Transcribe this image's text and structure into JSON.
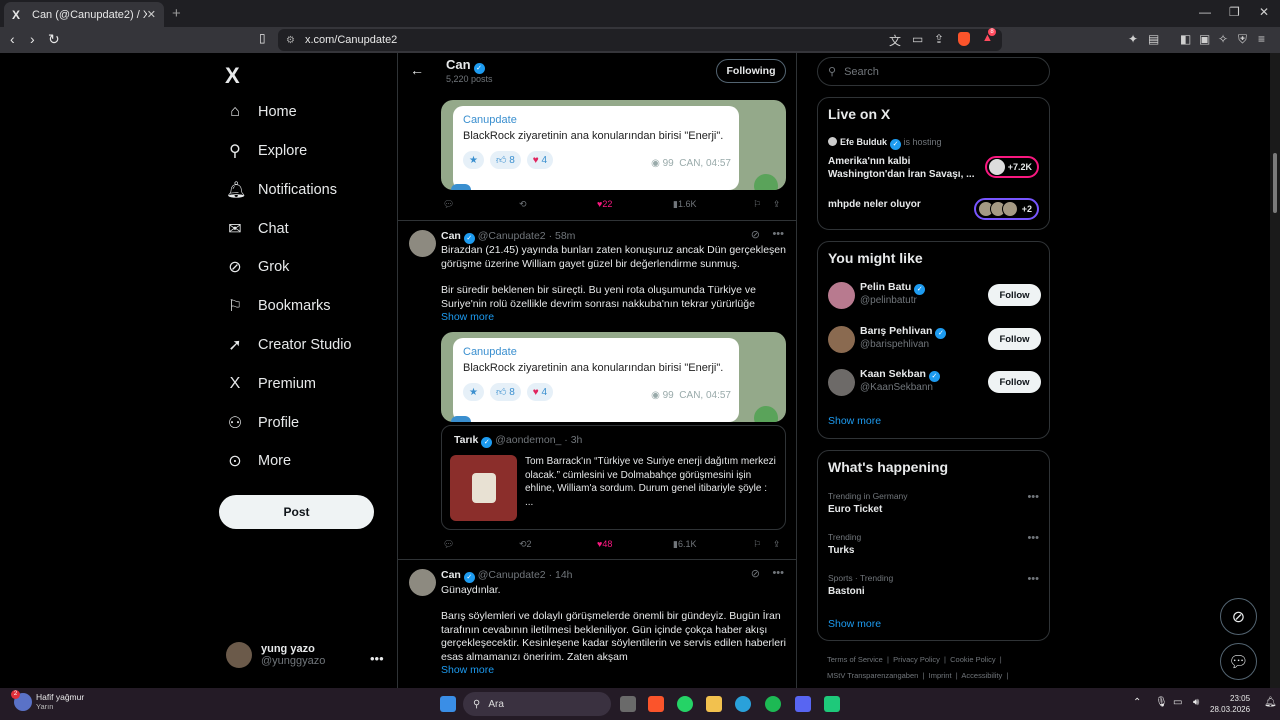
{
  "browser": {
    "tab_title": "Can (@Canupdate2) / X",
    "tab_favicon": "X",
    "url": "x.com/Canupdate2",
    "shield_badge": "8"
  },
  "sidebar": {
    "logo": "X",
    "items": [
      {
        "label": "Home",
        "icon": "home-icon"
      },
      {
        "label": "Explore",
        "icon": "search-icon"
      },
      {
        "label": "Notifications",
        "icon": "bell-icon"
      },
      {
        "label": "Chat",
        "icon": "mail-icon"
      },
      {
        "label": "Grok",
        "icon": "grok-icon"
      },
      {
        "label": "Bookmarks",
        "icon": "bookmark-icon"
      },
      {
        "label": "Creator Studio",
        "icon": "rocket-icon"
      },
      {
        "label": "Premium",
        "icon": "x-logo-icon"
      },
      {
        "label": "Profile",
        "icon": "person-icon"
      },
      {
        "label": "More",
        "icon": "more-circle-icon"
      }
    ],
    "post_label": "Post",
    "account": {
      "name": "yung yazo",
      "handle": "@yunggyazo"
    }
  },
  "profile": {
    "name": "Can",
    "posts": "5,220 posts",
    "following_label": "Following"
  },
  "embed": {
    "channel": "Canupdate",
    "message": "BlackRock ziyaretinin ana konularından birisi \"Enerji\".",
    "reaction_star": "★",
    "reaction_like": "8",
    "reaction_heart": "4",
    "views": "99",
    "meta": "CAN, 04:57"
  },
  "tweets": [
    {
      "actions": {
        "likes": "22",
        "views": "1.6K"
      }
    },
    {
      "name": "Can",
      "handle": "@Canupdate2",
      "time": "· 58m",
      "text1": "Birazdan (21.45) yayında bunları zaten konuşuruz ancak Dün gerçekleşen görüşme üzerine William gayet güzel bir değerlendirme sunmuş.",
      "text2": "Bir süredir beklenen bir süreçti. Bu yeni rota oluşumunda Türkiye ve Suriye'nin rolü özellikle devrim sonrası nakkuba'nın tekrar yürürlüğe",
      "show_more": "Show more",
      "quote": {
        "name": "Tarık",
        "handle": "@aondemon_",
        "time": "· 3h",
        "text": "Tom Barrack'ın “Türkiye ve Suriye enerji dağıtım merkezi olacak.” cümlesini ve Dolmabahçe görüşmesini işin ehline, William'a sordum. Durum genel itibariyle şöyle :",
        "ellipsis": "..."
      },
      "actions": {
        "reposts": "2",
        "likes": "48",
        "views": "6.1K"
      }
    },
    {
      "name": "Can",
      "handle": "@Canupdate2",
      "time": "· 14h",
      "text1": "Günaydınlar.",
      "text2": "Barış söylemleri ve dolaylı görüşmelerde önemli bir gündeyiz. Bugün İran tarafının cevabının iletilmesi bekleniliyor. Gün içinde çokça haber akışı gerçekleşecektir. Kesinleşene kadar söylentilerin ve servis edilen haberleri esas almamanızı öneririm. Zaten akşam",
      "show_more": "Show more"
    }
  ],
  "right": {
    "search_placeholder": "Search",
    "live": {
      "title": "Live on X",
      "host_name": "Efe Bulduk",
      "host_suffix": "is hosting",
      "item1": "Amerika'nın kalbi Washington'dan İran Savaşı, ...",
      "item1_count": "+7.2K",
      "item2": "mhpde neler oluyor",
      "item2_count": "+2"
    },
    "might_like": {
      "title": "You might like",
      "people": [
        {
          "name": "Pelin Batu",
          "handle": "@pelinbatutr",
          "button": "Follow"
        },
        {
          "name": "Barış Pehlivan",
          "handle": "@barispehlivan",
          "button": "Follow"
        },
        {
          "name": "Kaan Sekban",
          "handle": "@KaanSekbann",
          "button": "Follow"
        }
      ],
      "show_more": "Show more"
    },
    "happening": {
      "title": "What's happening",
      "trends": [
        {
          "context": "Trending in Germany",
          "name": "Euro Ticket"
        },
        {
          "context": "Trending",
          "name": "Turks"
        },
        {
          "context": "Sports · Trending",
          "name": "Bastoni"
        }
      ],
      "show_more": "Show more"
    },
    "footer": {
      "line1": [
        "Terms of Service",
        "Privacy Policy",
        "Cookie Policy"
      ],
      "line2": [
        "MStV Transparenzangaben",
        "Imprint",
        "Accessibility"
      ]
    }
  },
  "taskbar": {
    "weather_title": "Hafif yağmur",
    "weather_sub": "Yarın",
    "weather_badge": "2",
    "search_label": "Ara",
    "time": "23:05",
    "date": "28.03.2026"
  },
  "colors": {
    "accent": "#1d9bf0",
    "like": "#f91880",
    "background": "#000000"
  }
}
